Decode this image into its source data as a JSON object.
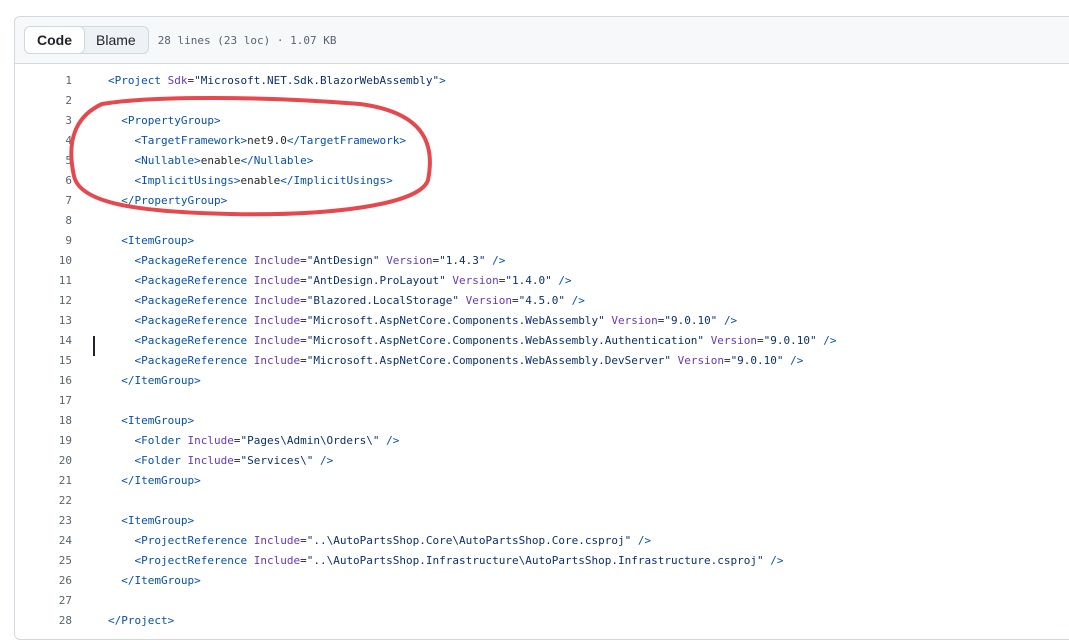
{
  "toolbar": {
    "code_label": "Code",
    "blame_label": "Blame",
    "file_meta": "28 lines (23 loc) · 1.07 KB"
  },
  "lines": [
    {
      "n": "1",
      "indent": 0,
      "t": [
        [
          "tag",
          "<Project "
        ],
        [
          "attr",
          "Sdk"
        ],
        [
          "txt",
          "="
        ],
        [
          "str",
          "\"Microsoft.NET.Sdk.BlazorWebAssembly\""
        ],
        [
          "tag",
          ">"
        ]
      ]
    },
    {
      "n": "2",
      "indent": 0,
      "t": []
    },
    {
      "n": "3",
      "indent": 2,
      "t": [
        [
          "tag",
          "<PropertyGroup>"
        ]
      ]
    },
    {
      "n": "4",
      "indent": 4,
      "t": [
        [
          "tag",
          "<TargetFramework>"
        ],
        [
          "txt",
          "net9.0"
        ],
        [
          "tag",
          "</TargetFramework>"
        ]
      ]
    },
    {
      "n": "5",
      "indent": 4,
      "t": [
        [
          "tag",
          "<Nullable>"
        ],
        [
          "txt",
          "enable"
        ],
        [
          "tag",
          "</Nullable>"
        ]
      ]
    },
    {
      "n": "6",
      "indent": 4,
      "t": [
        [
          "tag",
          "<ImplicitUsings>"
        ],
        [
          "txt",
          "enable"
        ],
        [
          "tag",
          "</ImplicitUsings>"
        ]
      ]
    },
    {
      "n": "7",
      "indent": 2,
      "t": [
        [
          "tag",
          "</PropertyGroup>"
        ]
      ]
    },
    {
      "n": "8",
      "indent": 0,
      "t": []
    },
    {
      "n": "9",
      "indent": 2,
      "t": [
        [
          "tag",
          "<ItemGroup>"
        ]
      ]
    },
    {
      "n": "10",
      "indent": 4,
      "t": [
        [
          "tag",
          "<PackageReference "
        ],
        [
          "attr",
          "Include"
        ],
        [
          "txt",
          "="
        ],
        [
          "str",
          "\"AntDesign\""
        ],
        [
          "txt",
          " "
        ],
        [
          "attr",
          "Version"
        ],
        [
          "txt",
          "="
        ],
        [
          "str",
          "\"1.4.3\""
        ],
        [
          "txt",
          " "
        ],
        [
          "tag",
          "/>"
        ]
      ]
    },
    {
      "n": "11",
      "indent": 4,
      "t": [
        [
          "tag",
          "<PackageReference "
        ],
        [
          "attr",
          "Include"
        ],
        [
          "txt",
          "="
        ],
        [
          "str",
          "\"AntDesign.ProLayout\""
        ],
        [
          "txt",
          " "
        ],
        [
          "attr",
          "Version"
        ],
        [
          "txt",
          "="
        ],
        [
          "str",
          "\"1.4.0\""
        ],
        [
          "txt",
          " "
        ],
        [
          "tag",
          "/>"
        ]
      ]
    },
    {
      "n": "12",
      "indent": 4,
      "t": [
        [
          "tag",
          "<PackageReference "
        ],
        [
          "attr",
          "Include"
        ],
        [
          "txt",
          "="
        ],
        [
          "str",
          "\"Blazored.LocalStorage\""
        ],
        [
          "txt",
          " "
        ],
        [
          "attr",
          "Version"
        ],
        [
          "txt",
          "="
        ],
        [
          "str",
          "\"4.5.0\""
        ],
        [
          "txt",
          " "
        ],
        [
          "tag",
          "/>"
        ]
      ]
    },
    {
      "n": "13",
      "indent": 4,
      "t": [
        [
          "tag",
          "<PackageReference "
        ],
        [
          "attr",
          "Include"
        ],
        [
          "txt",
          "="
        ],
        [
          "str",
          "\"Microsoft.AspNetCore.Components.WebAssembly\""
        ],
        [
          "txt",
          " "
        ],
        [
          "attr",
          "Version"
        ],
        [
          "txt",
          "="
        ],
        [
          "str",
          "\"9.0.10\""
        ],
        [
          "txt",
          " "
        ],
        [
          "tag",
          "/>"
        ]
      ]
    },
    {
      "n": "14",
      "indent": 4,
      "t": [
        [
          "tag",
          "<PackageReference "
        ],
        [
          "attr",
          "Include"
        ],
        [
          "txt",
          "="
        ],
        [
          "str",
          "\"Microsoft.AspNetCore.Components.WebAssembly.Authentication\""
        ],
        [
          "txt",
          " "
        ],
        [
          "attr",
          "Version"
        ],
        [
          "txt",
          "="
        ],
        [
          "str",
          "\"9.0.10\""
        ],
        [
          "txt",
          " "
        ],
        [
          "tag",
          "/>"
        ]
      ]
    },
    {
      "n": "15",
      "indent": 4,
      "t": [
        [
          "tag",
          "<PackageReference "
        ],
        [
          "attr",
          "Include"
        ],
        [
          "txt",
          "="
        ],
        [
          "str",
          "\"Microsoft.AspNetCore.Components.WebAssembly.DevServer\""
        ],
        [
          "txt",
          " "
        ],
        [
          "attr",
          "Version"
        ],
        [
          "txt",
          "="
        ],
        [
          "str",
          "\"9.0.10\""
        ],
        [
          "txt",
          " "
        ],
        [
          "tag",
          "/>"
        ]
      ]
    },
    {
      "n": "16",
      "indent": 2,
      "t": [
        [
          "tag",
          "</ItemGroup>"
        ]
      ]
    },
    {
      "n": "17",
      "indent": 0,
      "t": []
    },
    {
      "n": "18",
      "indent": 2,
      "t": [
        [
          "tag",
          "<ItemGroup>"
        ]
      ]
    },
    {
      "n": "19",
      "indent": 4,
      "t": [
        [
          "tag",
          "<Folder "
        ],
        [
          "attr",
          "Include"
        ],
        [
          "txt",
          "="
        ],
        [
          "str",
          "\"Pages\\Admin\\Orders\\\""
        ],
        [
          "txt",
          " "
        ],
        [
          "tag",
          "/>"
        ]
      ]
    },
    {
      "n": "20",
      "indent": 4,
      "t": [
        [
          "tag",
          "<Folder "
        ],
        [
          "attr",
          "Include"
        ],
        [
          "txt",
          "="
        ],
        [
          "str",
          "\"Services\\\""
        ],
        [
          "txt",
          " "
        ],
        [
          "tag",
          "/>"
        ]
      ]
    },
    {
      "n": "21",
      "indent": 2,
      "t": [
        [
          "tag",
          "</ItemGroup>"
        ]
      ]
    },
    {
      "n": "22",
      "indent": 0,
      "t": []
    },
    {
      "n": "23",
      "indent": 2,
      "t": [
        [
          "tag",
          "<ItemGroup>"
        ]
      ]
    },
    {
      "n": "24",
      "indent": 4,
      "t": [
        [
          "tag",
          "<ProjectReference "
        ],
        [
          "attr",
          "Include"
        ],
        [
          "txt",
          "="
        ],
        [
          "str",
          "\"..\\AutoPartsShop.Core\\AutoPartsShop.Core.csproj\""
        ],
        [
          "txt",
          " "
        ],
        [
          "tag",
          "/>"
        ]
      ]
    },
    {
      "n": "25",
      "indent": 4,
      "t": [
        [
          "tag",
          "<ProjectReference "
        ],
        [
          "attr",
          "Include"
        ],
        [
          "txt",
          "="
        ],
        [
          "str",
          "\"..\\AutoPartsShop.Infrastructure\\AutoPartsShop.Infrastructure.csproj\""
        ],
        [
          "txt",
          " "
        ],
        [
          "tag",
          "/>"
        ]
      ]
    },
    {
      "n": "26",
      "indent": 2,
      "t": [
        [
          "tag",
          "</ItemGroup>"
        ]
      ]
    },
    {
      "n": "27",
      "indent": 0,
      "t": []
    },
    {
      "n": "28",
      "indent": 0,
      "t": [
        [
          "tag",
          "</Project>"
        ]
      ]
    }
  ],
  "colors": {
    "tag": "#0550ae",
    "attr": "#6639ba",
    "string": "#0a3069",
    "annotation": "#e5484d"
  }
}
